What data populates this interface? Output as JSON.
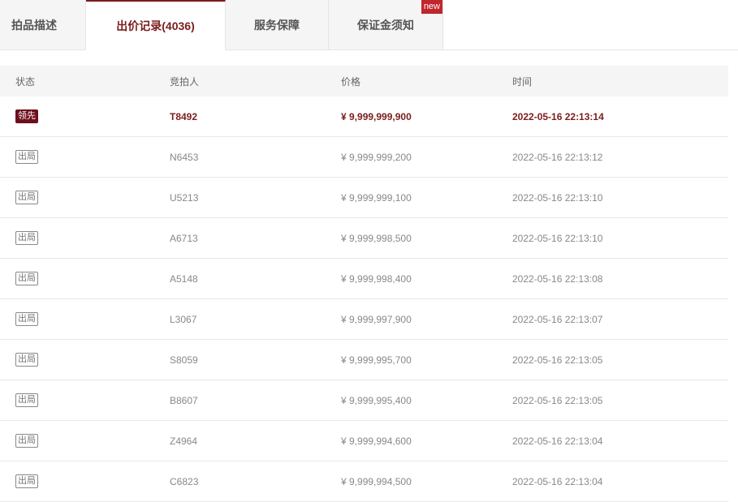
{
  "tabs": [
    {
      "label": "拍品描述"
    },
    {
      "label": "出价记录(4036)"
    },
    {
      "label": "服务保障"
    },
    {
      "label": "保证金须知",
      "badge": "new"
    }
  ],
  "table": {
    "headers": [
      "状态",
      "竞拍人",
      "价格",
      "时间"
    ],
    "rows": [
      {
        "status": "领先",
        "bidder": "T8492",
        "price": "¥ 9,999,999,900",
        "time": "2022-05-16 22:13:14"
      },
      {
        "status": "出局",
        "bidder": "N6453",
        "price": "¥ 9,999,999,200",
        "time": "2022-05-16 22:13:12"
      },
      {
        "status": "出局",
        "bidder": "U5213",
        "price": "¥ 9,999,999,100",
        "time": "2022-05-16 22:13:10"
      },
      {
        "status": "出局",
        "bidder": "A6713",
        "price": "¥ 9,999,998,500",
        "time": "2022-05-16 22:13:10"
      },
      {
        "status": "出局",
        "bidder": "A5148",
        "price": "¥ 9,999,998,400",
        "time": "2022-05-16 22:13:08"
      },
      {
        "status": "出局",
        "bidder": "L3067",
        "price": "¥ 9,999,997,900",
        "time": "2022-05-16 22:13:07"
      },
      {
        "status": "出局",
        "bidder": "S8059",
        "price": "¥ 9,999,995,700",
        "time": "2022-05-16 22:13:05"
      },
      {
        "status": "出局",
        "bidder": "B8607",
        "price": "¥ 9,999,995,400",
        "time": "2022-05-16 22:13:05"
      },
      {
        "status": "出局",
        "bidder": "Z4964",
        "price": "¥ 9,999,994,600",
        "time": "2022-05-16 22:13:04"
      },
      {
        "status": "出局",
        "bidder": "C6823",
        "price": "¥ 9,999,994,500",
        "time": "2022-05-16 22:13:04"
      }
    ]
  },
  "colors": {
    "accent": "#7a1d1d",
    "leading_badge": "#6d0f1c",
    "new_badge": "#c0262c"
  }
}
